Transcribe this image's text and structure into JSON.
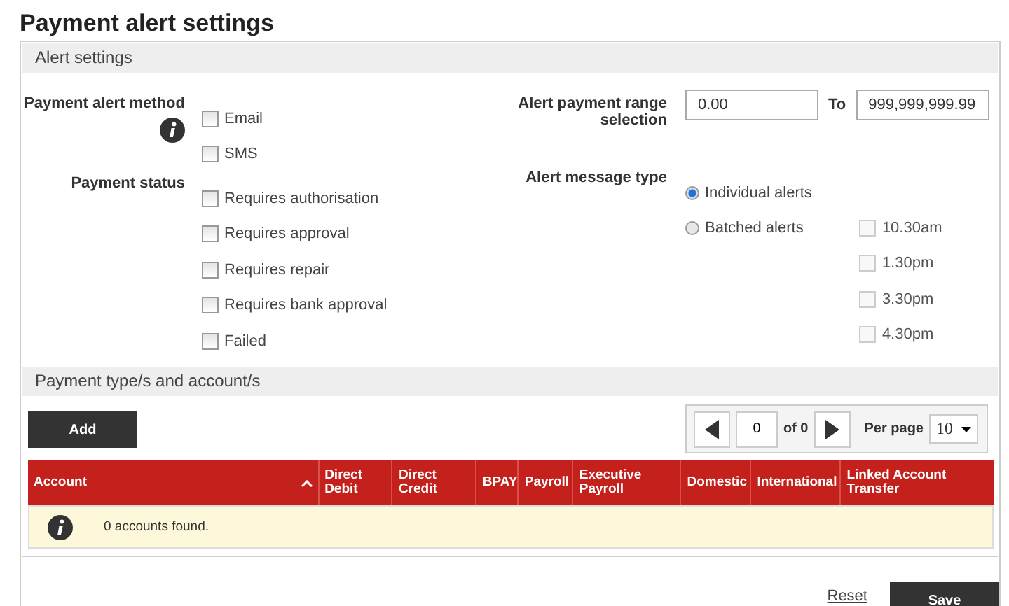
{
  "title": "Payment alert settings",
  "alert_settings": {
    "heading": "Alert settings",
    "alert_method": {
      "label": "Payment alert method",
      "options": [
        {
          "label": "Email",
          "checked": false
        },
        {
          "label": "SMS",
          "checked": false
        }
      ]
    },
    "payment_status": {
      "label": "Payment status",
      "options": [
        {
          "label": "Requires authorisation",
          "checked": false
        },
        {
          "label": "Requires approval",
          "checked": false
        },
        {
          "label": "Requires repair",
          "checked": false
        },
        {
          "label": "Requires bank approval",
          "checked": false
        },
        {
          "label": "Failed",
          "checked": false
        }
      ]
    },
    "range": {
      "label": "Alert payment range selection",
      "from": "0.00",
      "to_label": "To",
      "to": "999,999,999.99"
    },
    "message_type": {
      "label": "Alert message type",
      "options": [
        {
          "label": "Individual alerts",
          "selected": true
        },
        {
          "label": "Batched alerts",
          "selected": false
        }
      ],
      "batch_times": [
        {
          "label": "10.30am",
          "checked": false,
          "disabled": true
        },
        {
          "label": "1.30pm",
          "checked": false,
          "disabled": true
        },
        {
          "label": "3.30pm",
          "checked": false,
          "disabled": true
        },
        {
          "label": "4.30pm",
          "checked": false,
          "disabled": true
        }
      ]
    }
  },
  "accounts": {
    "heading": "Payment type/s and account/s",
    "add_button": "Add",
    "pager": {
      "page": "0",
      "of": "of 0",
      "per_page_label": "Per page",
      "per_page": "10"
    },
    "table": {
      "columns": [
        {
          "label": "Account",
          "sortable": true
        },
        {
          "label": "Direct Debit",
          "sortable": false
        },
        {
          "label": "Direct Credit",
          "sortable": false
        },
        {
          "label": "BPAY",
          "sortable": false
        },
        {
          "label": "Payroll",
          "sortable": false
        },
        {
          "label": "Executive Payroll",
          "sortable": false
        },
        {
          "label": "Domestic",
          "sortable": false
        },
        {
          "label": "International",
          "sortable": false
        },
        {
          "label": "Linked Account Transfer",
          "sortable": false
        }
      ],
      "empty_message": "0 accounts found."
    }
  },
  "footer": {
    "reset": "Reset",
    "save": "Save"
  }
}
